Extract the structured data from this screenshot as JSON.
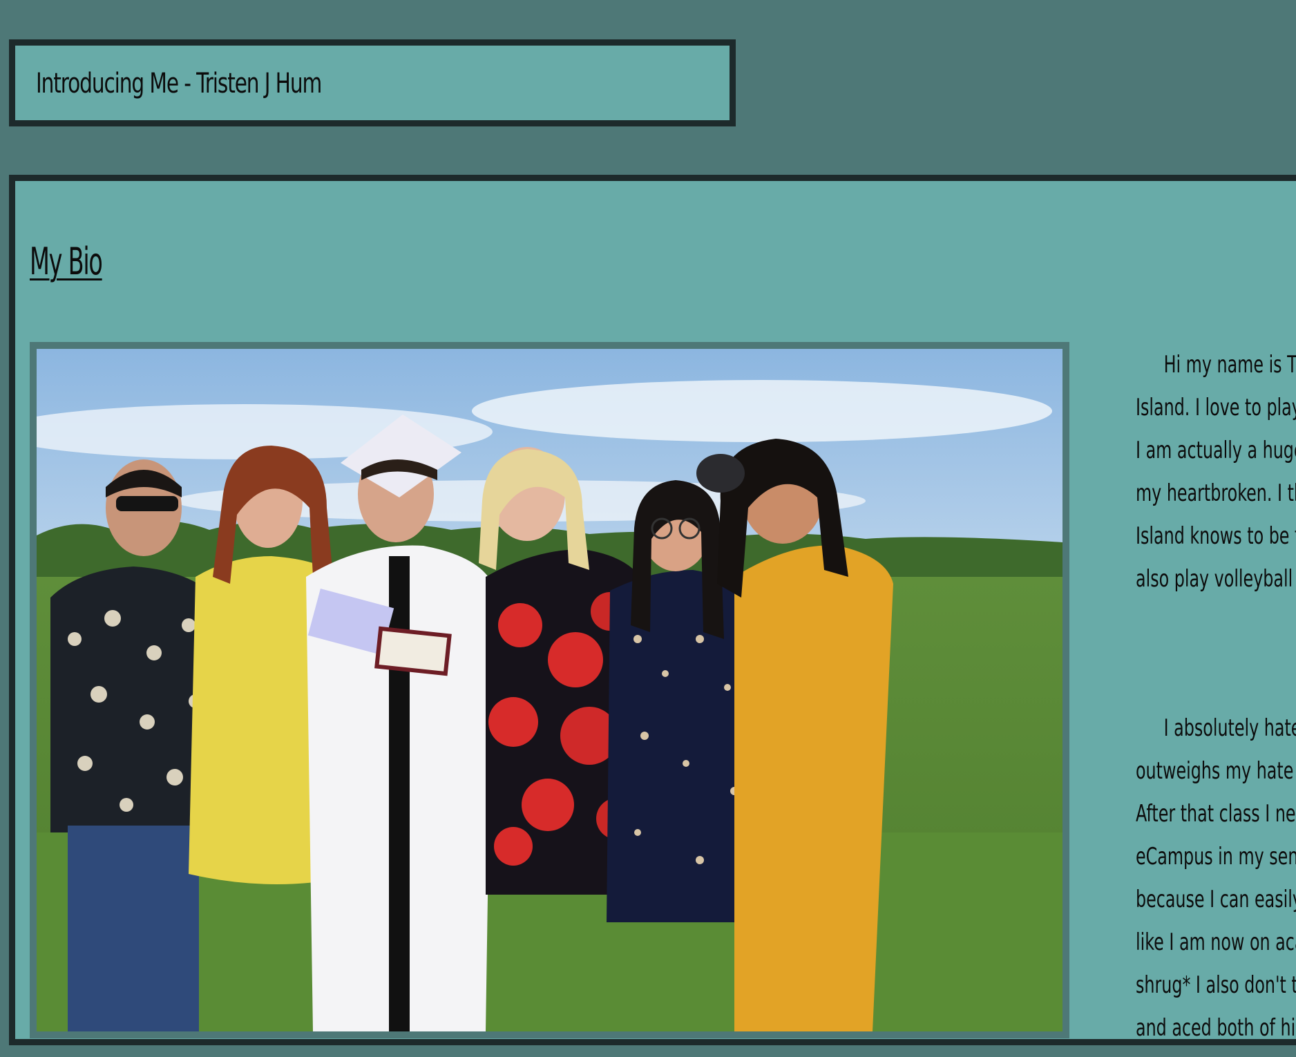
{
  "header": {
    "title": "Introducing Me - Tristen J Hum"
  },
  "bio_section": {
    "heading": "My Bio",
    "photo_label": "graduation-group-photo",
    "paragraphs": [
      {
        "lines": [
          "Hi my name is Tri",
          "Island. I love to play v",
          "I am actually a huge n",
          "my heartbroken. I thir",
          "Island knows to be fair",
          "also play volleyball ever"
        ]
      },
      {
        "lines": [
          "I absolutely hate a",
          "outweighs my hate for",
          "After that class I neve",
          "eCampus in my senior",
          "because I can easily pa",
          "like I am now on acade",
          "shrug* I also don't thi",
          "and aced both of his fi"
        ]
      }
    ]
  },
  "colors": {
    "page_background": "#4e7877",
    "panel_background": "#68aba8",
    "border": "#1d2a2b"
  }
}
